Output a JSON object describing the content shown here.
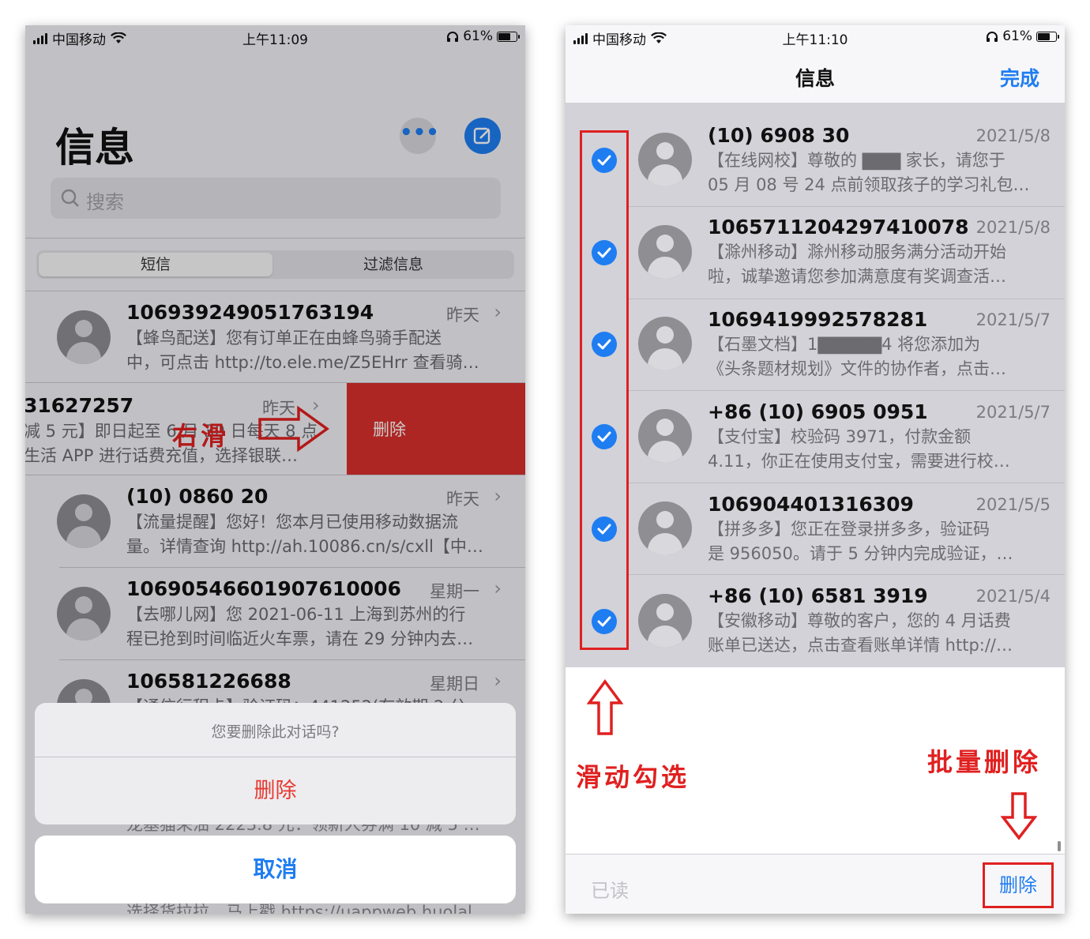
{
  "left_phone": {
    "status": {
      "carrier": "中国移动",
      "time": "上午11:09",
      "battery": "61%"
    },
    "title": "信息",
    "search_placeholder": "搜索",
    "tabs": [
      "短信",
      "过滤信息"
    ],
    "messages": [
      {
        "name": "106939249051763194",
        "time": "昨天",
        "preview1": "【蜂鸟配送】您有订单正在由蜂鸟骑手配送",
        "preview2": "中，可点击 http://to.ele.me/Z5EHrr 查看骑…"
      },
      {
        "name": "31627257",
        "time": "昨天",
        "preview1": "减 5 元】即日起至 6 月 30 日每天 8 点",
        "preview2": "生活 APP 进行话费充值，选择银联…"
      },
      {
        "name": "(10) 0860 20",
        "time": "昨天",
        "preview1": "【流量提醒】您好！您本月已使用移动数据流",
        "preview2": "量。详情查询 http://ah.10086.cn/s/cxll【中…"
      },
      {
        "name": "10690546601907610006",
        "time": "星期一",
        "preview1": "【去哪儿网】您 2021-06-11 上海到苏州的行",
        "preview2": "程已抢到时间临近火车票，请在 29 分钟内去…"
      },
      {
        "name": "106581226688",
        "time": "星期日",
        "preview1": "【通信行程卡】验证码：441252(有效期 2 分",
        "preview2": ""
      }
    ],
    "swipe_delete": "删除",
    "swipe_note": "右滑",
    "action_sheet": {
      "question": "您要删除此对话吗?",
      "delete": "删除",
      "cancel": "取消"
    },
    "behind_text_1": "龙基猫采油 2223.8 元：领新人券满 10 减 5 …",
    "behind_text_2": "选择货拉拉，马上戳 https://uappweb.huolal…"
  },
  "right_phone": {
    "status": {
      "carrier": "中国移动",
      "time": "上午11:10",
      "battery": "61%"
    },
    "title": "信息",
    "done": "完成",
    "messages": [
      {
        "name": "(10) 6908 30",
        "time": "2021/5/8",
        "preview1": "【在线网校】尊敬的 ▇▇▇ 家长，请您于",
        "preview2": "05 月 08 号 24 点前领取孩子的学习礼包…",
        "checked": true
      },
      {
        "name": "1065711204297410078",
        "time": "2021/5/8",
        "preview1": "【滁州移动】滁州移动服务满分活动开始",
        "preview2": "啦，诚挚邀请您参加满意度有奖调查活…",
        "checked": true
      },
      {
        "name": "1069419992578281",
        "time": "2021/5/7",
        "preview1": "【石墨文档】1▇▇▇▇▇4 将您添加为",
        "preview2": "《头条题材规划》文件的协作者，点击…",
        "checked": true
      },
      {
        "name": "+86 (10) 6905 0951",
        "time": "2021/5/7",
        "preview1": "【支付宝】校验码 3971，付款金额",
        "preview2": "4.11，你正在使用支付宝，需要进行校…",
        "checked": true
      },
      {
        "name": "106904401316309",
        "time": "2021/5/5",
        "preview1": "【拼多多】您正在登录拼多多，验证码",
        "preview2": "是 956050。请于 5 分钟内完成验证，…",
        "checked": true
      },
      {
        "name": "+86 (10) 6581 3919",
        "time": "2021/5/4",
        "preview1": "【安徽移动】尊敬的客户，您的 4 月话费",
        "preview2": "账单已送达，点击查看账单详情 http://…",
        "checked": true
      }
    ],
    "note_swipe_select": "滑动勾选",
    "note_batch_delete": "批量删除",
    "toolbar": {
      "read": "已读",
      "delete": "删除"
    }
  },
  "colors": {
    "ios_blue": "#1f7df2",
    "delete_red": "#d9302c",
    "annotation_red": "#e02020"
  }
}
